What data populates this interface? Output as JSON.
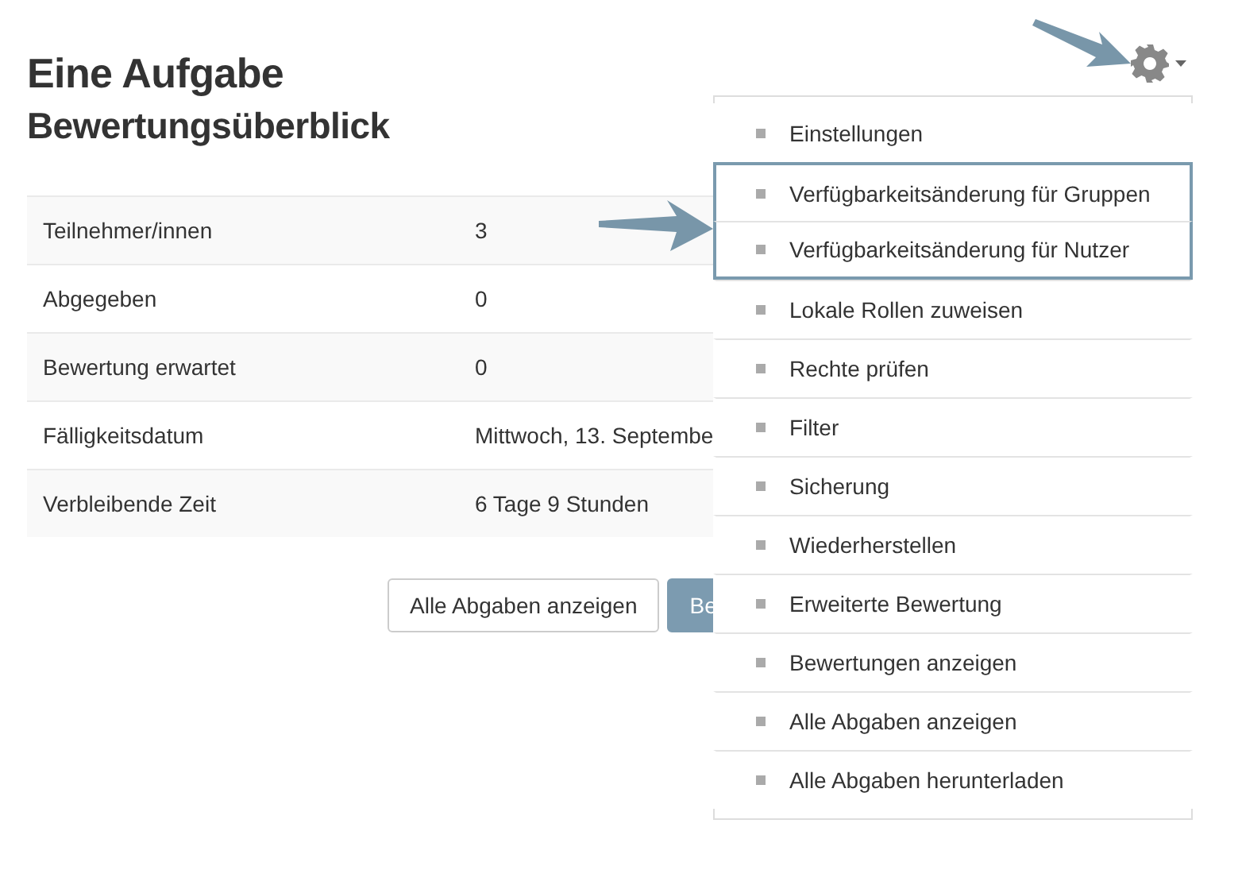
{
  "heading": {
    "title": "Eine Aufgabe",
    "subtitle": "Bewertungsüberblick"
  },
  "summary": [
    {
      "label": "Teilnehmer/innen",
      "value": "3"
    },
    {
      "label": "Abgegeben",
      "value": "0"
    },
    {
      "label": "Bewertung erwartet",
      "value": "0"
    },
    {
      "label": "Fälligkeitsdatum",
      "value": "Mittwoch, 13. Septembe"
    },
    {
      "label": "Verbleibende Zeit",
      "value": "6 Tage 9 Stunden"
    }
  ],
  "buttons": [
    {
      "label": "Alle Abgaben anzeigen",
      "kind": "secondary"
    },
    {
      "label": "Be",
      "kind": "primary"
    }
  ],
  "settings_menu": {
    "items": [
      {
        "label": "Einstellungen",
        "highlighted": false
      },
      {
        "label": "Verfügbarkeitsänderung für Gruppen",
        "highlighted": true
      },
      {
        "label": "Verfügbarkeitsänderung für Nutzer",
        "highlighted": true
      },
      {
        "label": "Lokale Rollen zuweisen",
        "highlighted": false
      },
      {
        "label": "Rechte prüfen",
        "highlighted": false
      },
      {
        "label": "Filter",
        "highlighted": false
      },
      {
        "label": "Sicherung",
        "highlighted": false
      },
      {
        "label": "Wiederherstellen",
        "highlighted": false
      },
      {
        "label": "Erweiterte Bewertung",
        "highlighted": false
      },
      {
        "label": "Bewertungen anzeigen",
        "highlighted": false
      },
      {
        "label": "Alle Abgaben anzeigen",
        "highlighted": false
      },
      {
        "label": "Alle Abgaben herunterladen",
        "highlighted": false
      }
    ]
  }
}
